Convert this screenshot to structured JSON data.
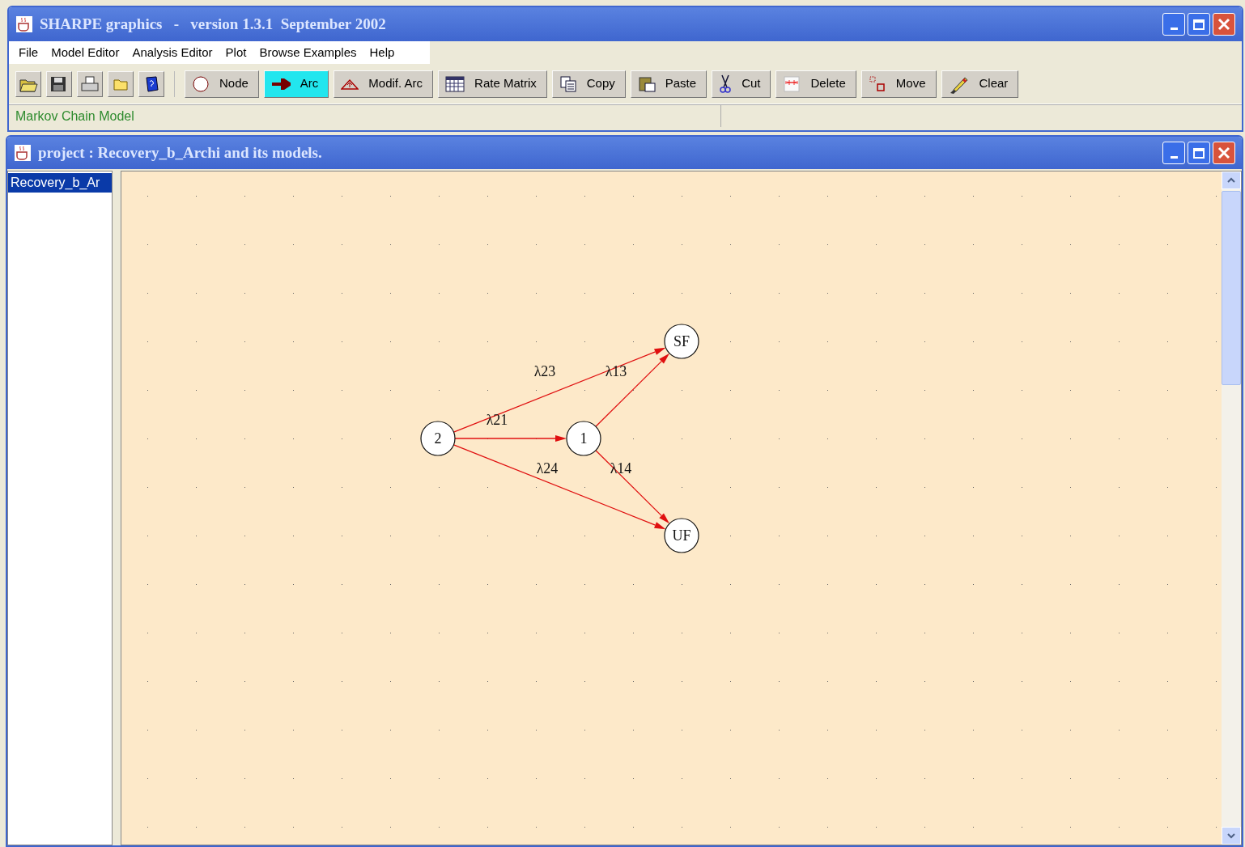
{
  "window": {
    "title": "SHARPE graphics   -   version 1.3.1  September 2002"
  },
  "menu": [
    "File",
    "Model Editor",
    "Analysis Editor",
    "Plot",
    "Browse Examples",
    "Help"
  ],
  "toolbar": {
    "tools": [
      {
        "label": "Node",
        "selected": false
      },
      {
        "label": "Arc",
        "selected": true
      },
      {
        "label": "Modif. Arc",
        "selected": false
      },
      {
        "label": "Rate Matrix",
        "selected": false
      },
      {
        "label": "Copy",
        "selected": false
      },
      {
        "label": "Paste",
        "selected": false
      },
      {
        "label": "Cut",
        "selected": false
      },
      {
        "label": "Delete",
        "selected": false
      },
      {
        "label": "Move",
        "selected": false
      },
      {
        "label": "Clear",
        "selected": false
      }
    ]
  },
  "status_bar": {
    "model_type": "Markov Chain Model"
  },
  "project_window": {
    "title": "project : Recovery_b_Archi and its models.",
    "tree": [
      {
        "label": "Recovery_b_Ar",
        "selected": true
      }
    ],
    "diagram": {
      "nodes": [
        "2",
        "1",
        "SF",
        "UF"
      ],
      "arcs": [
        {
          "label": "λ23"
        },
        {
          "label": "λ13"
        },
        {
          "label": "λ21"
        },
        {
          "label": "λ24"
        },
        {
          "label": "λ14"
        }
      ]
    }
  }
}
